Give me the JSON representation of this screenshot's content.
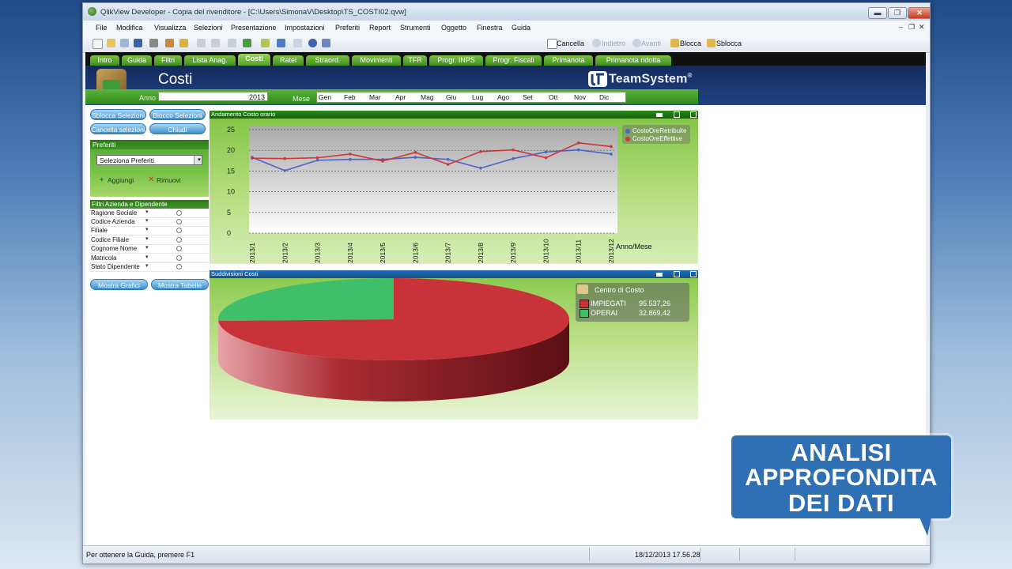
{
  "window": {
    "title": "QlikView Developer - Copia del rivenditore - [C:\\Users\\SimonaV\\Desktop\\TS_COSTI02.qvw]",
    "btn_min": "▬",
    "btn_max": "❐",
    "btn_close": "✕"
  },
  "menu": [
    "File",
    "Modifica",
    "Visualizza",
    "Selezioni",
    "Presentazione",
    "Impostazioni",
    "Preferiti",
    "Report",
    "Strumenti",
    "Oggetto",
    "Finestra",
    "Guida"
  ],
  "menu_controls": [
    "‒",
    "❐",
    "✕"
  ],
  "toolbar": {
    "cancella": "Cancella",
    "indietro": "Indietro",
    "avanti": "Avanti",
    "blocca": "Blocca",
    "sblocca": "Sblocca"
  },
  "tabs": [
    "Intro",
    "Guida",
    "Filtri",
    "Lista Anag.",
    "Costi",
    "Ratei",
    "Straord.",
    "Movimenti",
    "TFR",
    "Progr. INPS",
    "Progr. Fiscali",
    "Primanota",
    "Primanota ridotta"
  ],
  "active_tab": "Costi",
  "header": {
    "page_title": "Costi",
    "brand": "TeamSystem",
    "brand_mark": "®"
  },
  "filters": {
    "anno_label": "Anno",
    "anno_value": "2013",
    "mese_label": "Mese",
    "mesi": [
      "Gen",
      "Feb",
      "Mar",
      "Apr",
      "Mag",
      "Giu",
      "Lug",
      "Ago",
      "Set",
      "Ott",
      "Nov",
      "Dic"
    ]
  },
  "left": {
    "btn_sblocca": "Sblocca Selezioni",
    "btn_blocco": "Blocco Selezioni",
    "btn_cancella": "Cancella selezioni",
    "btn_chiudi": "Chiudi",
    "preferiti_title": "Preferiti",
    "preferiti_select": "Seleziona Preferiti",
    "aggiungi": "Aggiungi",
    "rimuovi": "Rimuovi",
    "filtri_title": "Filtri Azienda e Dipendente",
    "filtri": [
      "Ragione Sociale",
      "Codice Azienda",
      "Filiale",
      "Codice Filiale",
      "Cognome Nome",
      "Matricola",
      "Stato Dipendente"
    ],
    "btn_grafici": "Mostra Grafici",
    "btn_tabelle": "Mostra Tabelle"
  },
  "chart_data": [
    {
      "type": "line",
      "title": "Andamento Costo orario",
      "xlabel": "Anno/Mese",
      "ylabel": "",
      "categories": [
        "2013/1",
        "2013/2",
        "2013/3",
        "2013/4",
        "2013/5",
        "2013/6",
        "2013/7",
        "2013/8",
        "2013/9",
        "2013/10",
        "2013/11",
        "2013/12"
      ],
      "series": [
        {
          "name": "CostoOreRetribuite",
          "color": "#4b66c6",
          "values": [
            18.3,
            15.1,
            17.6,
            17.8,
            17.8,
            18.3,
            17.8,
            15.7,
            18.0,
            19.6,
            20.1,
            19.1
          ]
        },
        {
          "name": "CostoOreEffettive",
          "color": "#cf3636",
          "values": [
            18.1,
            18.0,
            18.2,
            19.1,
            17.4,
            19.5,
            16.6,
            19.7,
            20.1,
            18.2,
            21.8,
            20.9
          ]
        }
      ],
      "yticks": [
        0,
        5,
        10,
        15,
        20,
        25
      ],
      "ylim": [
        0,
        25
      ],
      "grid": true,
      "legend": "top-right"
    },
    {
      "type": "pie",
      "title": "Suddivisioni Costi",
      "legend_title": "Centro di Costo",
      "slices": [
        {
          "label": "IMPIEGATI",
          "value": 95537.26,
          "display": "95.537,26",
          "color": "#c8333a"
        },
        {
          "label": "OPERAI",
          "value": 32869.42,
          "display": "32.869,42",
          "color": "#3fbf6a"
        }
      ],
      "legend": "top-right"
    }
  ],
  "status": {
    "help": "Per ottenere la Guida, premere F1",
    "datetime": "18/12/2013 17.56.28"
  },
  "callout": {
    "lines": [
      "ANALISI",
      "APPROFONDITA",
      "DEI DATI"
    ]
  }
}
